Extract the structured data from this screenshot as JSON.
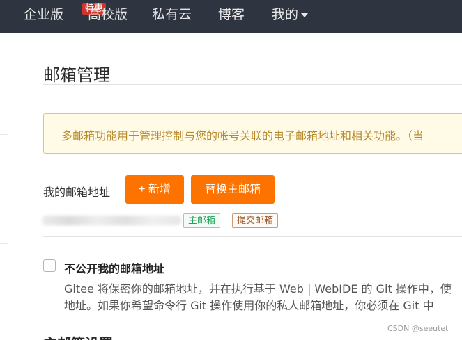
{
  "nav": {
    "items": [
      {
        "label": "企业版",
        "badge": "特惠"
      },
      {
        "label": "高校版"
      },
      {
        "label": "私有云"
      },
      {
        "label": "博客"
      },
      {
        "label": "我的"
      }
    ]
  },
  "main": {
    "title": "邮箱管理",
    "notice": "多邮箱功能用于管理控制与您的帐号关联的电子邮箱地址和相关功能。（当",
    "email_row": {
      "label": "我的邮箱地址",
      "add_button": "+ 新增",
      "replace_button": "替换主邮箱",
      "tags": [
        "主邮箱",
        "提交邮箱"
      ]
    },
    "privacy": {
      "title": "不公开我的邮箱地址",
      "desc_line1": "Gitee 将保密你的邮箱地址，并在执行基于 Web | WebIDE 的 Git 操作中，使",
      "desc_line2": "地址。如果你希望命令行 Git 操作使用你的私人邮箱地址，你必须在 Git 中"
    },
    "next_section": "主邮箱设置"
  },
  "watermark": "CSDN @seeutet",
  "colors": {
    "nav_bg": "#2e3540",
    "accent": "#fe7300",
    "notice_bg": "#fffbe6",
    "notice_text": "#b88a2e",
    "tag_primary": "#22a55a",
    "tag_commit": "#9a5b2e"
  }
}
